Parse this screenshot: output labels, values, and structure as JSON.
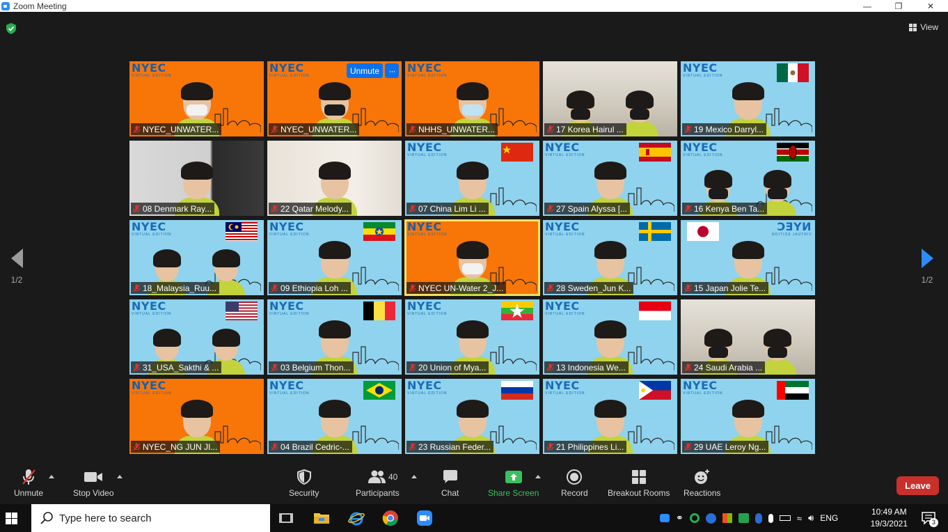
{
  "window": {
    "title": "Zoom Meeting",
    "minimize": "—",
    "restore": "❐",
    "close": "✕"
  },
  "stage": {
    "view_label": "View",
    "page_indicator_left": "1/2",
    "page_indicator_right": "1/2"
  },
  "tiles": [
    {
      "name": "NYEC_UNWATER...",
      "bg": "orange",
      "flag": "",
      "mask": "white",
      "logo": true
    },
    {
      "name": "NYEC_UNWATER...",
      "bg": "orange",
      "flag": "",
      "mask": "black",
      "logo": true,
      "hover": true
    },
    {
      "name": "NHHS_UNWATER...",
      "bg": "orange",
      "flag": "",
      "mask": "blue",
      "logo": true
    },
    {
      "name": "17 Korea Hairul ...",
      "bg": "room",
      "flag": "",
      "mask": "black",
      "logo": false,
      "two": true
    },
    {
      "name": "19 Mexico Darryl...",
      "bg": "blue",
      "flag": "mexico",
      "mask": "",
      "logo": true
    },
    {
      "name": "08 Denmark Ray...",
      "bg": "wall",
      "flag": "",
      "mask": "",
      "logo": false
    },
    {
      "name": "22 Qatar Melody...",
      "bg": "curtain",
      "flag": "",
      "mask": "",
      "logo": false
    },
    {
      "name": "07 China Lim Li ...",
      "bg": "blue",
      "flag": "china",
      "mask": "",
      "logo": true
    },
    {
      "name": "27 Spain Alyssa [...",
      "bg": "blue",
      "flag": "spain",
      "mask": "",
      "logo": true
    },
    {
      "name": "16 Kenya Ben Ta...",
      "bg": "blue",
      "flag": "kenya",
      "mask": "black",
      "logo": true,
      "two": true
    },
    {
      "name": "18_Malaysia_Ruu...",
      "bg": "blue",
      "flag": "malaysia",
      "mask": "",
      "logo": true,
      "two": true
    },
    {
      "name": "09 Ethiopia Loh ...",
      "bg": "blue",
      "flag": "ethiopia",
      "mask": "",
      "logo": true
    },
    {
      "name": "NYEC UN-Water 2_J...",
      "bg": "orange",
      "flag": "",
      "mask": "white",
      "logo": true,
      "active": true
    },
    {
      "name": "28 Sweden_Jun K...",
      "bg": "blue",
      "flag": "sweden",
      "mask": "",
      "logo": true
    },
    {
      "name": "15 Japan Jolie Te...",
      "bg": "blue",
      "flag": "japan",
      "mask": "",
      "logo": true,
      "mirror": true
    },
    {
      "name": "31_USA_Sakthi & ...",
      "bg": "blue",
      "flag": "usa",
      "mask": "",
      "logo": true,
      "two": true
    },
    {
      "name": "03 Belgium Thon...",
      "bg": "blue",
      "flag": "belgium",
      "mask": "",
      "logo": true
    },
    {
      "name": "20 Union of Mya...",
      "bg": "blue",
      "flag": "myanmar",
      "mask": "",
      "logo": true
    },
    {
      "name": "13 Indonesia We...",
      "bg": "blue",
      "flag": "indonesia",
      "mask": "",
      "logo": true
    },
    {
      "name": "24 Saudi Arabia ...",
      "bg": "room",
      "flag": "",
      "mask": "black",
      "logo": false,
      "two": true
    },
    {
      "name": "NYEC_NG JUN JI...",
      "bg": "orange",
      "flag": "",
      "mask": "",
      "logo": true
    },
    {
      "name": "04 Brazil Cedric-...",
      "bg": "blue",
      "flag": "brazil",
      "mask": "",
      "logo": true
    },
    {
      "name": "23 Russian Feder...",
      "bg": "blue",
      "flag": "russia",
      "mask": "",
      "logo": true
    },
    {
      "name": "21 Philippines Li...",
      "bg": "blue",
      "flag": "philippines",
      "mask": "",
      "logo": true
    },
    {
      "name": "29 UAE Leroy Ng...",
      "bg": "blue",
      "flag": "uae",
      "mask": "",
      "logo": true
    }
  ],
  "overlay": {
    "nyec": "NYEC",
    "virtual_edition": "VIRTUAL EDITION",
    "unmute_pill": "Unmute",
    "more_pill": "···"
  },
  "toolbar": {
    "unmute": "Unmute",
    "stop_video": "Stop Video",
    "security": "Security",
    "participants": "Participants",
    "participant_count": "40",
    "chat": "Chat",
    "share_screen": "Share Screen",
    "record": "Record",
    "breakout_rooms": "Breakout Rooms",
    "reactions": "Reactions",
    "leave": "Leave"
  },
  "taskbar": {
    "search_placeholder": "Type here to search",
    "language": "ENG",
    "time": "10:49 AM",
    "date": "19/3/2021",
    "notification_count": "3"
  },
  "colors": {
    "orange_bg": "#f87508",
    "blue_bg": "#8fd3ee",
    "share_green": "#3ac05e",
    "leave_red": "#c9302c",
    "accent_blue": "#2d8cff"
  }
}
